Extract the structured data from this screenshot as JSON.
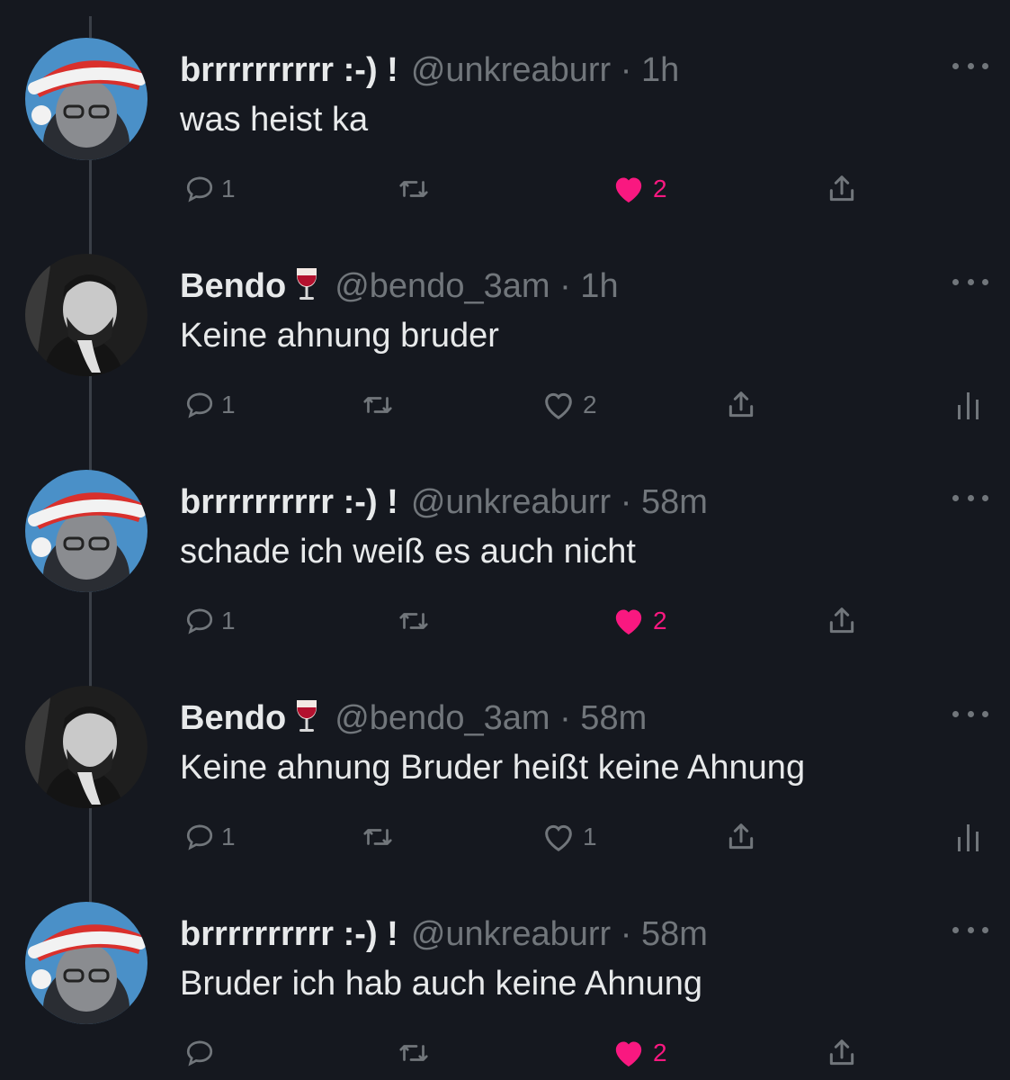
{
  "tweets": [
    {
      "name": "brrrrrrrrrr :-) !",
      "handle": "@unkreaburr",
      "time": "· 1h",
      "text": "was heist ka",
      "reply_count": "1",
      "like_count": "2",
      "liked": true,
      "wine_emoji": false
    },
    {
      "name": "Bendo",
      "handle": "@bendo_3am",
      "time": "· 1h",
      "text": "Keine ahnung bruder",
      "reply_count": "1",
      "like_count": "2",
      "liked": false,
      "wine_emoji": true
    },
    {
      "name": "brrrrrrrrrr :-) !",
      "handle": "@unkreaburr",
      "time": "· 58m",
      "text": "schade ich weiß es auch nicht",
      "reply_count": "1",
      "like_count": "2",
      "liked": true,
      "wine_emoji": false
    },
    {
      "name": "Bendo",
      "handle": "@bendo_3am",
      "time": "· 58m",
      "text": "Keine ahnung Bruder heißt keine Ahnung",
      "reply_count": "1",
      "like_count": "1",
      "liked": false,
      "wine_emoji": true
    },
    {
      "name": "brrrrrrrrrr :-) !",
      "handle": "@unkreaburr",
      "time": "· 58m",
      "text": "Bruder ich hab auch keine Ahnung",
      "reply_count": "",
      "like_count": "2",
      "liked": true,
      "wine_emoji": false
    }
  ],
  "colors": {
    "background": "#15181f",
    "text": "#e7e9ea",
    "muted": "#71767b",
    "like": "#f91880",
    "thread_line": "#3a3f47"
  },
  "icons": {
    "reply": "speech-bubble-icon",
    "retweet": "retweet-arrows-icon",
    "like": "heart-icon",
    "share": "share-upload-icon",
    "analytics": "bar-chart-icon",
    "more": "three-dots-icon",
    "wine": "wine-glass-emoji"
  }
}
